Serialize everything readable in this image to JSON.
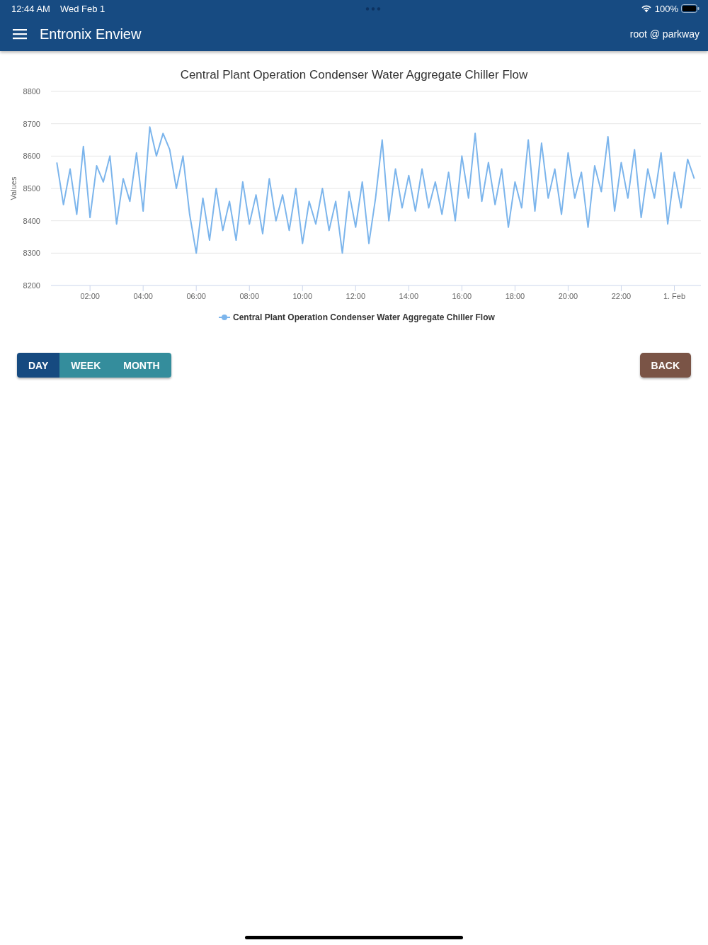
{
  "status_bar": {
    "time": "12:44 AM",
    "date": "Wed Feb 1",
    "battery": "100%"
  },
  "header": {
    "title": "Entronix Enview",
    "user": "root @ parkway"
  },
  "chart": {
    "chart_data": {
      "type": "line",
      "title": "Central Plant Operation Condenser Water Aggregate Chiller Flow",
      "ylabel": "Values",
      "x": [
        0.75,
        1,
        1.25,
        1.5,
        1.75,
        2,
        2.25,
        2.5,
        2.75,
        3,
        3.25,
        3.5,
        3.75,
        4,
        4.25,
        4.5,
        4.75,
        5,
        5.25,
        5.5,
        5.75,
        6,
        6.25,
        6.5,
        6.75,
        7,
        7.25,
        7.5,
        7.75,
        8,
        8.25,
        8.5,
        8.75,
        9,
        9.25,
        9.5,
        9.75,
        10,
        10.25,
        10.5,
        10.75,
        11,
        11.25,
        11.5,
        11.75,
        12,
        12.25,
        12.5,
        12.75,
        13,
        13.25,
        13.5,
        13.75,
        14,
        14.25,
        14.5,
        14.75,
        15,
        15.25,
        15.5,
        15.75,
        16,
        16.25,
        16.5,
        16.75,
        17,
        17.25,
        17.5,
        17.75,
        18,
        18.25,
        18.5,
        18.75,
        19,
        19.25,
        19.5,
        19.75,
        20,
        20.25,
        20.5,
        20.75,
        21,
        21.25,
        21.5,
        21.75,
        22,
        22.25,
        22.5,
        22.75,
        23,
        23.25,
        23.5,
        23.75,
        24,
        24.25,
        24.5,
        24.75
      ],
      "series": [
        {
          "name": "Central Plant Operation Condenser Water Aggregate Chiller Flow",
          "color": "#7cb5ec",
          "values": [
            8580,
            8450,
            8560,
            8420,
            8630,
            8410,
            8570,
            8520,
            8600,
            8390,
            8530,
            8460,
            8610,
            8430,
            8690,
            8600,
            8670,
            8620,
            8500,
            8600,
            8420,
            8300,
            8470,
            8340,
            8500,
            8370,
            8460,
            8340,
            8520,
            8390,
            8480,
            8360,
            8530,
            8400,
            8480,
            8370,
            8500,
            8330,
            8460,
            8390,
            8500,
            8370,
            8460,
            8300,
            8490,
            8380,
            8520,
            8330,
            8470,
            8650,
            8400,
            8560,
            8440,
            8540,
            8430,
            8560,
            8440,
            8520,
            8420,
            8550,
            8400,
            8600,
            8470,
            8670,
            8460,
            8580,
            8450,
            8560,
            8380,
            8520,
            8440,
            8650,
            8430,
            8640,
            8470,
            8560,
            8420,
            8610,
            8470,
            8550,
            8380,
            8570,
            8490,
            8660,
            8430,
            8580,
            8470,
            8620,
            8410,
            8560,
            8470,
            8610,
            8390,
            8550,
            8440,
            8590,
            8530
          ]
        }
      ],
      "xlim": [
        0.53,
        25
      ],
      "grid": true,
      "ylim": [
        8200,
        8800
      ],
      "yticks": [
        8200,
        8300,
        8400,
        8500,
        8600,
        8700,
        8800
      ],
      "xticks": [
        {
          "value": 2,
          "label": "02:00"
        },
        {
          "value": 4,
          "label": "04:00"
        },
        {
          "value": 6,
          "label": "06:00"
        },
        {
          "value": 8,
          "label": "08:00"
        },
        {
          "value": 10,
          "label": "10:00"
        },
        {
          "value": 12,
          "label": "12:00"
        },
        {
          "value": 14,
          "label": "14:00"
        },
        {
          "value": 16,
          "label": "16:00"
        },
        {
          "value": 18,
          "label": "18:00"
        },
        {
          "value": 20,
          "label": "20:00"
        },
        {
          "value": 22,
          "label": "22:00"
        },
        {
          "value": 24,
          "label": "1. Feb"
        }
      ]
    }
  },
  "range_tabs": [
    {
      "label": "DAY",
      "selected": true
    },
    {
      "label": "WEEK",
      "selected": false
    },
    {
      "label": "MONTH",
      "selected": false
    }
  ],
  "back_button": {
    "label": "BACK"
  }
}
